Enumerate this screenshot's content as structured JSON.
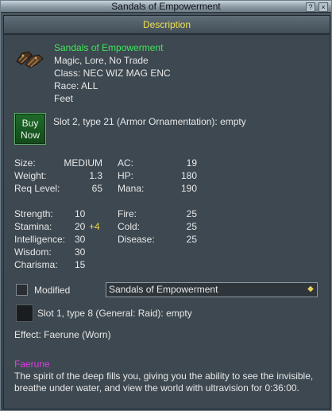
{
  "window": {
    "title": "Sandals of Empowerment",
    "help_btn": "?",
    "close_btn": "×"
  },
  "tab": {
    "label": "Description"
  },
  "item": {
    "name": "Sandals of Empowerment",
    "flags": "Magic, Lore, No Trade",
    "class": "Class: NEC WIZ MAG ENC",
    "race": "Race: ALL",
    "slot": "Feet"
  },
  "buy": {
    "line1": "Buy",
    "line2": "Now"
  },
  "augment_slot2": "Slot 2, type 21 (Armor Ornamentation): empty",
  "stats": {
    "size_label": "Size:",
    "size_value": "MEDIUM",
    "weight_label": "Weight:",
    "weight_value": "1.3",
    "reqlevel_label": "Req Level:",
    "reqlevel_value": "65",
    "ac_label": "AC:",
    "ac_value": "19",
    "hp_label": "HP:",
    "hp_value": "180",
    "mana_label": "Mana:",
    "mana_value": "190",
    "strength_label": "Strength:",
    "strength_value": "10",
    "stamina_label": "Stamina:",
    "stamina_value": "20",
    "stamina_bonus": "+4",
    "intelligence_label": "Intelligence:",
    "intelligence_value": "30",
    "wisdom_label": "Wisdom:",
    "wisdom_value": "30",
    "charisma_label": "Charisma:",
    "charisma_value": "15",
    "fire_label": "Fire:",
    "fire_value": "25",
    "cold_label": "Cold:",
    "cold_value": "25",
    "disease_label": "Disease:",
    "disease_value": "25"
  },
  "modified": {
    "label": "Modified",
    "checked": false,
    "dropdown_value": "Sandals of Empowerment"
  },
  "augment_slot1": "Slot 1, type 8 (General: Raid): empty",
  "effect": "Effect: Faerune (Worn)",
  "spell": {
    "name": "Faerune",
    "description": "The spirit of the deep fills you, giving you the ability to see the invisible, breathe under water, and view the world with ultravision for 0:36:00."
  },
  "colors": {
    "item_name": "#3fe85a",
    "tab_text": "#f0e050",
    "spell_name": "#e03ce8",
    "bonus": "#f0d24a"
  }
}
